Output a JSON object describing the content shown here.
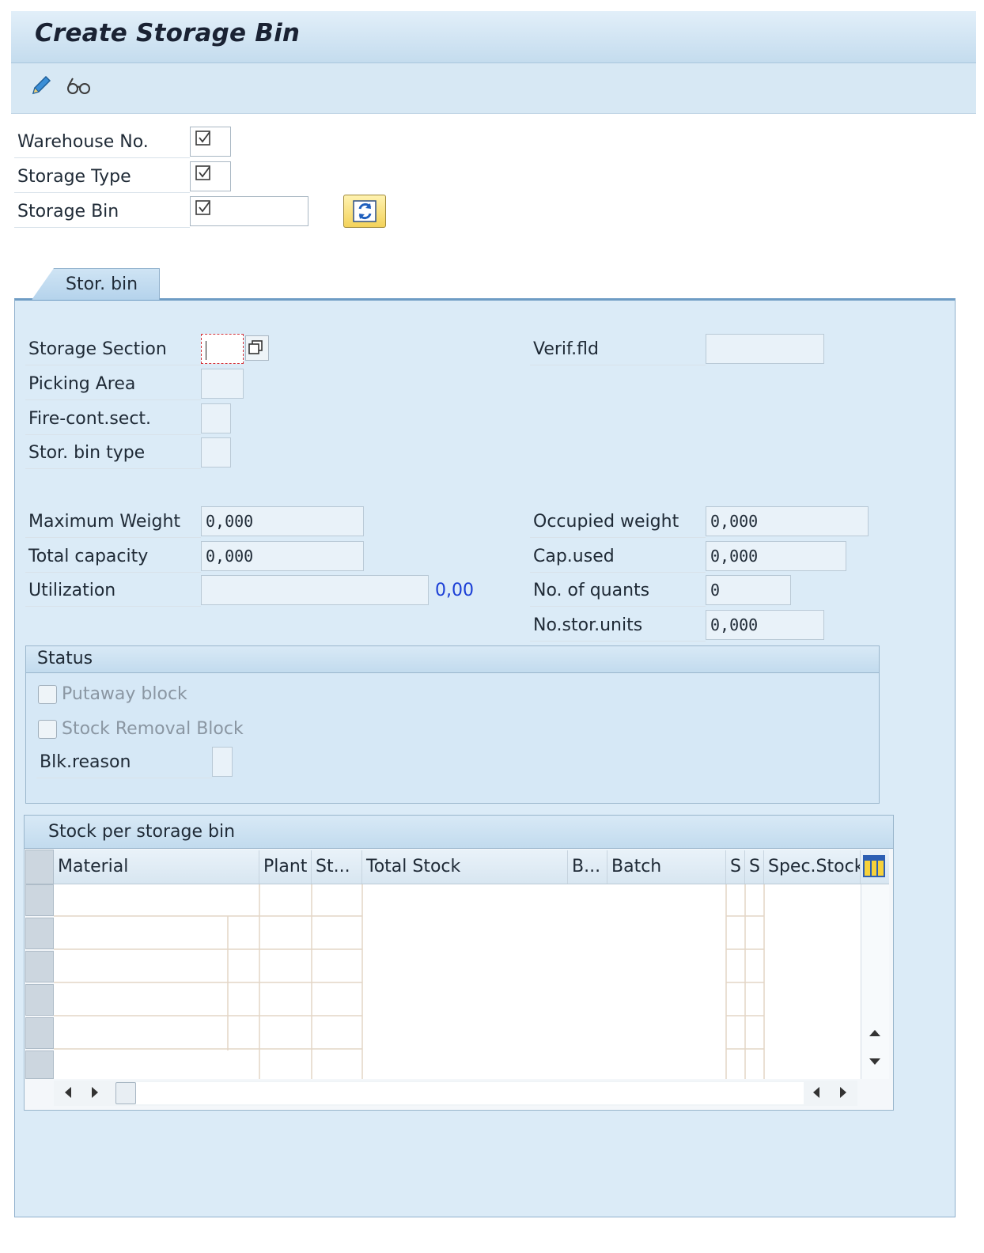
{
  "window": {
    "title": "Create Storage Bin"
  },
  "toolbar": {
    "edit_icon": "pencil-icon",
    "display_icon": "glasses-icon"
  },
  "header_fields": {
    "warehouse_no": {
      "label": "Warehouse No.",
      "value": ""
    },
    "storage_type": {
      "label": "Storage Type",
      "value": ""
    },
    "storage_bin": {
      "label": "Storage Bin",
      "value": ""
    }
  },
  "tabs": [
    {
      "label": "Stor. bin",
      "active": true
    }
  ],
  "bin": {
    "storage_section": {
      "label": "Storage Section",
      "value": ""
    },
    "picking_area": {
      "label": "Picking Area",
      "value": ""
    },
    "fire_cont_sect": {
      "label": "Fire-cont.sect.",
      "value": ""
    },
    "stor_bin_type": {
      "label": "Stor. bin type",
      "value": ""
    },
    "verif_fld": {
      "label": "Verif.fld",
      "value": ""
    },
    "maximum_weight": {
      "label": "Maximum Weight",
      "value": "0,000"
    },
    "total_capacity": {
      "label": "Total capacity",
      "value": "0,000"
    },
    "utilization": {
      "label": "Utilization",
      "value": "",
      "percent": "0,00"
    },
    "occupied_weight": {
      "label": "Occupied weight",
      "value": "0,000"
    },
    "cap_used": {
      "label": "Cap.used",
      "value": "0,000"
    },
    "no_of_quants": {
      "label": "No. of quants",
      "value": "0"
    },
    "no_stor_units": {
      "label": "No.stor.units",
      "value": "0,000"
    }
  },
  "status": {
    "title": "Status",
    "putaway_block": {
      "label": "Putaway block",
      "checked": false
    },
    "stock_removal_block": {
      "label": "Stock Removal Block",
      "checked": false
    },
    "blk_reason": {
      "label": "Blk.reason",
      "value": ""
    }
  },
  "stock": {
    "title": "Stock per storage bin",
    "columns": [
      "Material",
      "Plant",
      "St...",
      "Total Stock",
      "B...",
      "Batch",
      "S",
      "S",
      "Spec.Stock"
    ]
  },
  "colors": {
    "accent": "#6e9cc4",
    "panel": "#dbebf7",
    "link_blue": "#1b3fd6"
  }
}
